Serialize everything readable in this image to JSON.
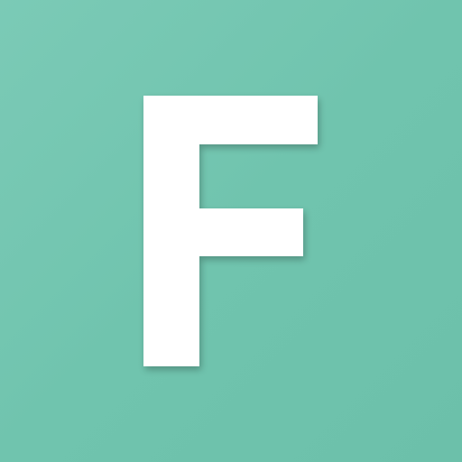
{
  "icon": {
    "letter": "F",
    "background_color": "#72c5b0",
    "letter_color": "#ffffff"
  }
}
